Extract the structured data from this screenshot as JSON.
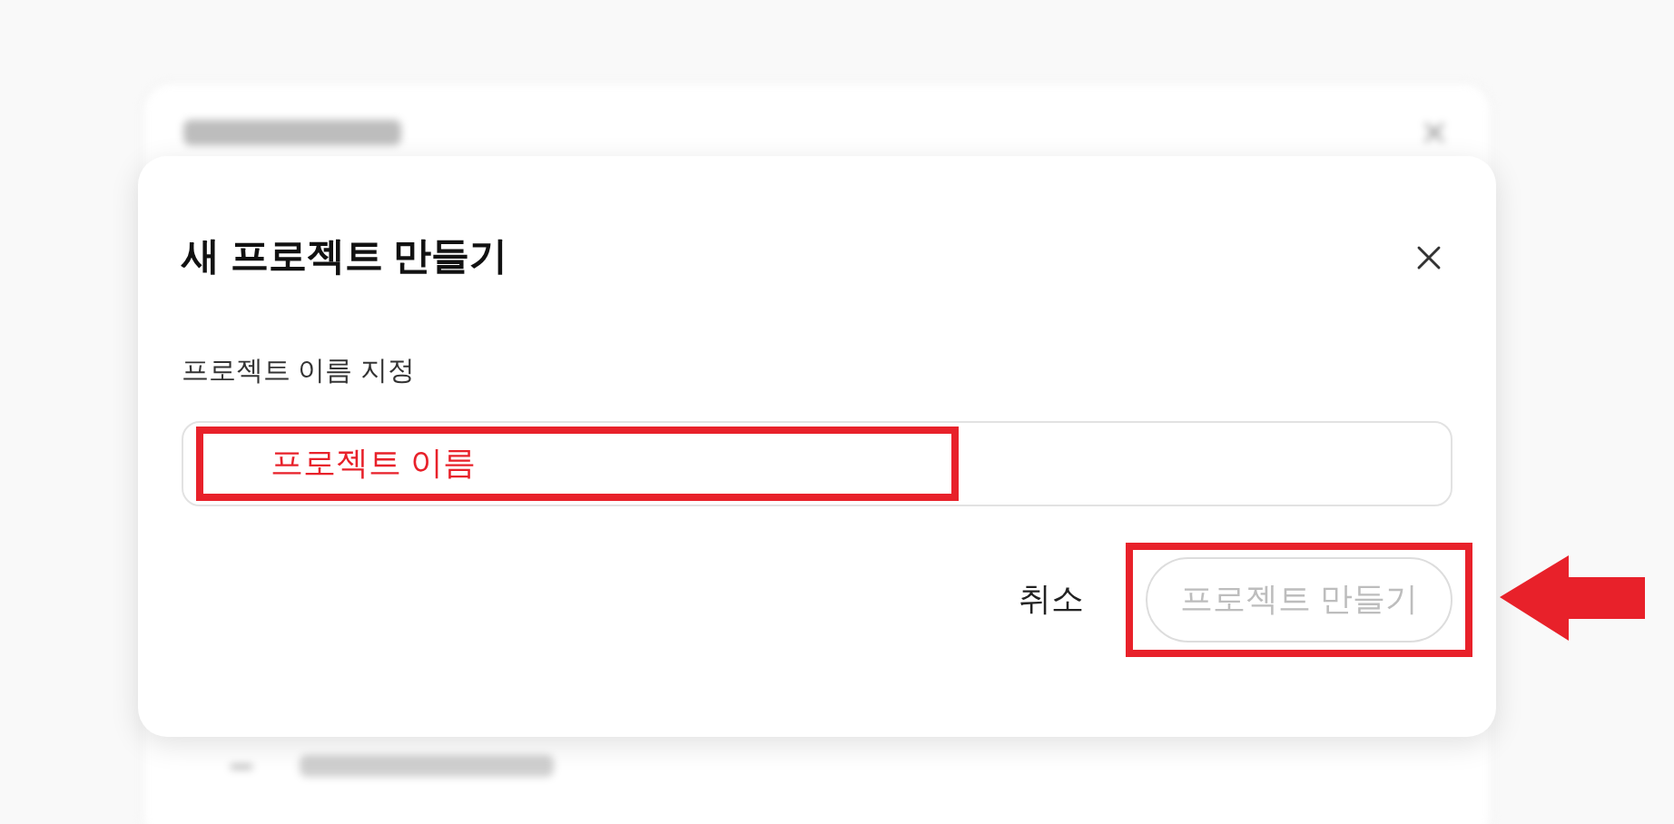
{
  "dialog": {
    "title": "새 프로젝트 만들기",
    "field_label": "프로젝트 이름 지정",
    "name_field": {
      "placeholder": "프로젝트 이름"
    },
    "buttons": [
      {
        "kind": "text",
        "label": "취소",
        "disabled": false
      },
      {
        "kind": "primary",
        "label": "프로젝트 만들기",
        "disabled": true
      }
    ]
  }
}
